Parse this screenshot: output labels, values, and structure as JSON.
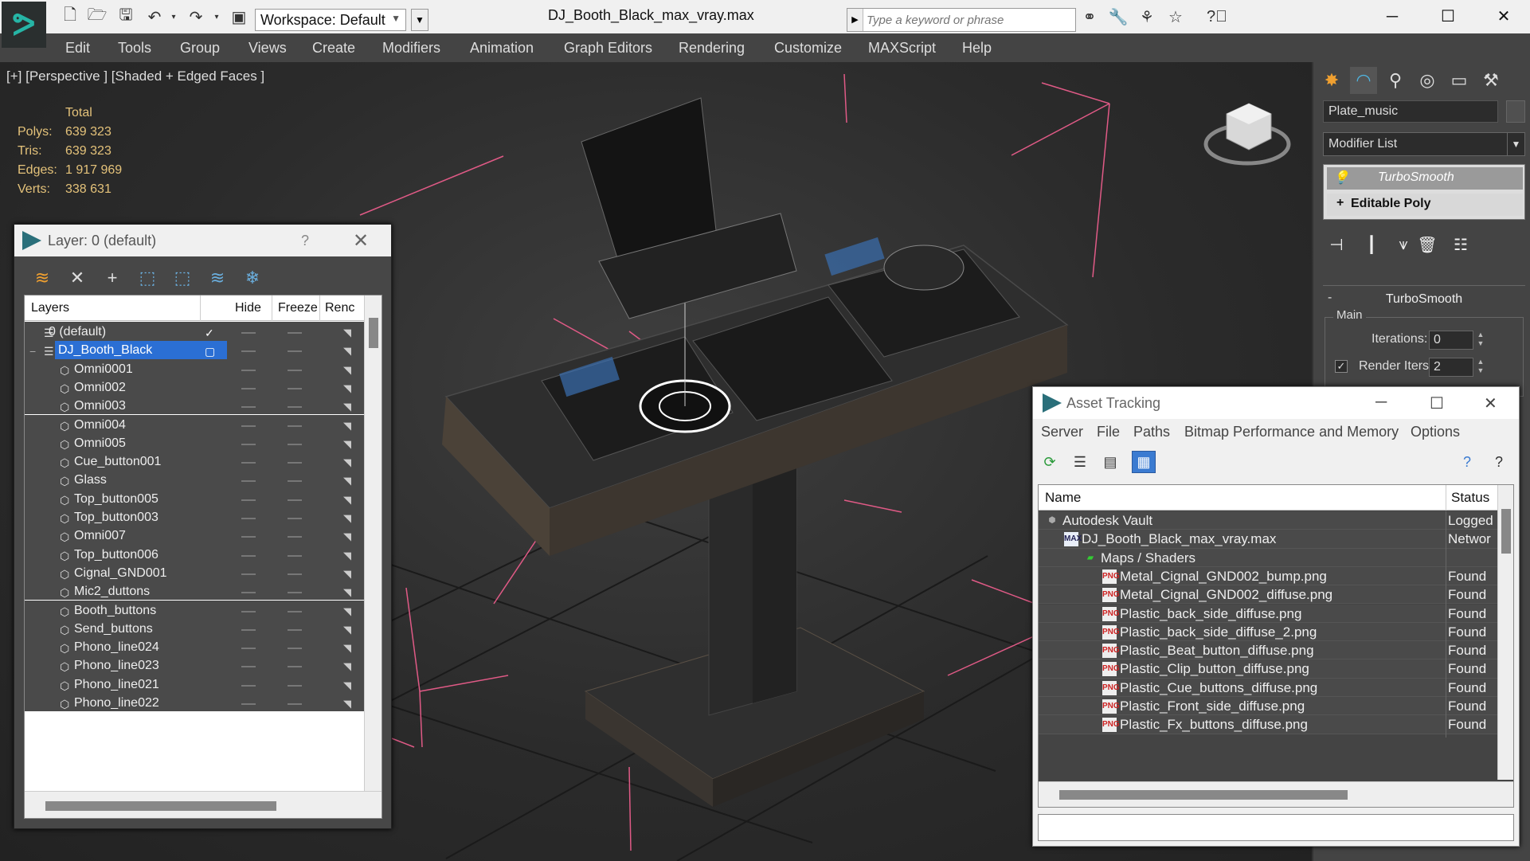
{
  "titlebar": {
    "workspace": "Workspace: Default",
    "doc_title": "DJ_Booth_Black_max_vray.max",
    "search_placeholder": "Type a keyword or phrase",
    "minimize": "─",
    "maximize": "☐",
    "close": "✕"
  },
  "menu": [
    "Edit",
    "Tools",
    "Group",
    "Views",
    "Create",
    "Modifiers",
    "Animation",
    "Graph Editors",
    "Rendering",
    "Customize",
    "MAXScript",
    "Help"
  ],
  "viewport": {
    "label": "[+] [Perspective ] [Shaded + Edged Faces ]",
    "stats_header": "Total",
    "stats": [
      {
        "label": "Polys:",
        "value": "639 323"
      },
      {
        "label": "Tris:",
        "value": "639 323"
      },
      {
        "label": "Edges:",
        "value": "1 917 969"
      },
      {
        "label": "Verts:",
        "value": "338 631"
      }
    ]
  },
  "command_panel": {
    "object_name": "Plate_music",
    "modifier_list": "Modifier List",
    "stack": [
      "TurboSmooth",
      "Editable Poly"
    ],
    "rollout_title": "TurboSmooth",
    "main_group": "Main",
    "iterations_label": "Iterations:",
    "iterations_value": "0",
    "render_iters_label": "Render Iters:",
    "render_iters_value": "2",
    "render_iters_checked": "✓"
  },
  "layer_dialog": {
    "title": "Layer: 0 (default)",
    "help": "?",
    "close": "✕",
    "columns": [
      "Layers",
      "Hide",
      "Freeze",
      "Renc"
    ],
    "rows": [
      {
        "name": "0 (default)",
        "type": "layer",
        "indent": 0,
        "active_mark": "✓"
      },
      {
        "name": "DJ_Booth_Black",
        "type": "layer",
        "indent": 0,
        "selected": true,
        "expander": "−"
      },
      {
        "name": "Omni0001",
        "type": "object",
        "indent": 1
      },
      {
        "name": "Omni002",
        "type": "object",
        "indent": 1
      },
      {
        "name": "Omni003",
        "type": "object",
        "indent": 1
      },
      {
        "name": "Omni004",
        "type": "object",
        "indent": 1
      },
      {
        "name": "Omni005",
        "type": "object",
        "indent": 1
      },
      {
        "name": "Cue_button001",
        "type": "object",
        "indent": 1
      },
      {
        "name": "Glass",
        "type": "object",
        "indent": 1
      },
      {
        "name": "Top_button005",
        "type": "object",
        "indent": 1
      },
      {
        "name": "Top_button003",
        "type": "object",
        "indent": 1
      },
      {
        "name": "Omni007",
        "type": "object",
        "indent": 1
      },
      {
        "name": "Top_button006",
        "type": "object",
        "indent": 1
      },
      {
        "name": "Cignal_GND001",
        "type": "object",
        "indent": 1
      },
      {
        "name": "Mic2_duttons",
        "type": "object",
        "indent": 1
      },
      {
        "name": "Booth_buttons",
        "type": "object",
        "indent": 1
      },
      {
        "name": "Send_buttons",
        "type": "object",
        "indent": 1
      },
      {
        "name": "Phono_line024",
        "type": "object",
        "indent": 1
      },
      {
        "name": "Phono_line023",
        "type": "object",
        "indent": 1
      },
      {
        "name": "Phono_line021",
        "type": "object",
        "indent": 1
      },
      {
        "name": "Phono_line022",
        "type": "object",
        "indent": 1
      }
    ]
  },
  "asset_dialog": {
    "title": "Asset Tracking",
    "minimize": "─",
    "maximize": "☐",
    "close": "✕",
    "menu": [
      "Server",
      "File",
      "Paths",
      "Bitmap Performance and Memory",
      "Options"
    ],
    "columns": [
      "Name",
      "Status"
    ],
    "rows": [
      {
        "name": "Autodesk Vault",
        "status": "Logged",
        "icon": "vault-icon",
        "indent": 0
      },
      {
        "name": "DJ_Booth_Black_max_vray.max",
        "status": "Networ",
        "icon": "max-file-icon",
        "indent": 1
      },
      {
        "name": "Maps / Shaders",
        "status": "",
        "icon": "maps-folder-icon",
        "indent": 2
      },
      {
        "name": "Metal_Cignal_GND002_bump.png",
        "status": "Found",
        "icon": "png-icon",
        "indent": 3
      },
      {
        "name": "Metal_Cignal_GND002_diffuse.png",
        "status": "Found",
        "icon": "png-icon",
        "indent": 3
      },
      {
        "name": "Plastic_back_side_diffuse.png",
        "status": "Found",
        "icon": "png-icon",
        "indent": 3
      },
      {
        "name": "Plastic_back_side_diffuse_2.png",
        "status": "Found",
        "icon": "png-icon",
        "indent": 3
      },
      {
        "name": "Plastic_Beat_button_diffuse.png",
        "status": "Found",
        "icon": "png-icon",
        "indent": 3
      },
      {
        "name": "Plastic_Clip_button_diffuse.png",
        "status": "Found",
        "icon": "png-icon",
        "indent": 3
      },
      {
        "name": "Plastic_Cue_buttons_diffuse.png",
        "status": "Found",
        "icon": "png-icon",
        "indent": 3
      },
      {
        "name": "Plastic_Front_side_diffuse.png",
        "status": "Found",
        "icon": "png-icon",
        "indent": 3
      },
      {
        "name": "Plastic_Fx_buttons_diffuse.png",
        "status": "Found",
        "icon": "png-icon",
        "indent": 3
      }
    ]
  },
  "colors": {
    "accent": "#2b6fd4",
    "stats": "#e4c27a",
    "app_teal": "#26b5a6",
    "viewport_bg": "#2b2b2b"
  }
}
